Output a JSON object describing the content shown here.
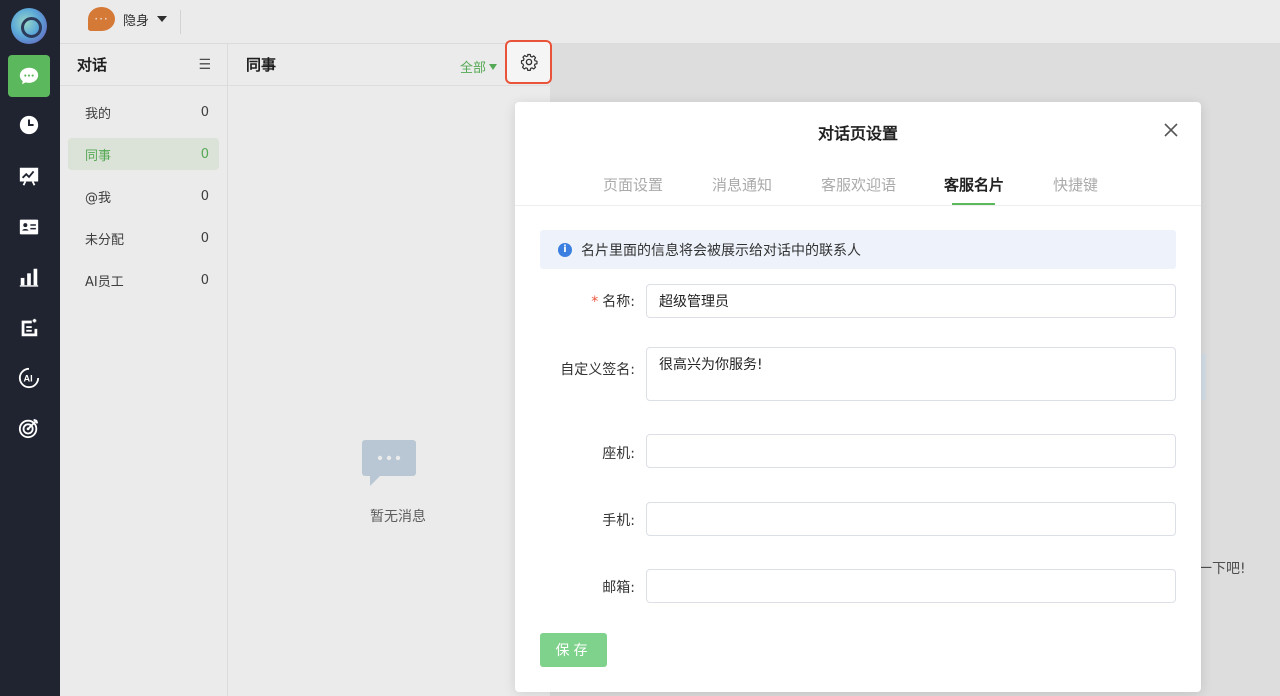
{
  "topbar": {
    "status_label": "隐身",
    "avatar_glyph": "···"
  },
  "sidebar": {
    "title": "对话",
    "menu_glyph": "☰",
    "items": [
      {
        "label": "我的",
        "count": "0"
      },
      {
        "label": "同事",
        "count": "0"
      },
      {
        "label": "@我",
        "count": "0"
      },
      {
        "label": "未分配",
        "count": "0"
      },
      {
        "label": "AI员工",
        "count": "0"
      }
    ]
  },
  "list": {
    "title": "同事",
    "filter_label": "全部",
    "empty_text": "暂无消息"
  },
  "background": {
    "hint_text": "一下吧!"
  },
  "modal": {
    "title": "对话页设置",
    "tabs": [
      "页面设置",
      "消息通知",
      "客服欢迎语",
      "客服名片",
      "快捷键"
    ],
    "active_tab": "客服名片",
    "info_text": "名片里面的信息将会被展示给对话中的联系人",
    "fields": {
      "name": {
        "label": "名称:",
        "value": "超级管理员",
        "required_mark": "*"
      },
      "signature": {
        "label": "自定义签名:",
        "value": "很高兴为你服务!"
      },
      "landline": {
        "label": "座机:",
        "value": ""
      },
      "mobile": {
        "label": "手机:",
        "value": ""
      },
      "email": {
        "label": "邮箱:",
        "value": ""
      }
    },
    "save_label": "保存"
  },
  "colors": {
    "brand": "#5cb85c",
    "rail": "#1f2430",
    "highlight": "#e8533a",
    "info_icon": "#3b7fe0"
  },
  "icons": [
    "chat-icon",
    "clock-icon",
    "chart-board-icon",
    "contact-card-icon",
    "bar-chart-icon",
    "ticket-icon",
    "ai-icon",
    "target-icon",
    "gear-icon",
    "close-icon",
    "info-icon",
    "message-bubble-icon"
  ]
}
